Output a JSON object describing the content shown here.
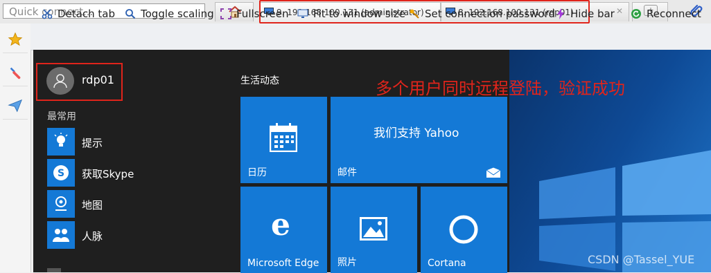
{
  "quick_connect": {
    "placeholder": "Quick connect..."
  },
  "tabs": [
    {
      "label": "9. 192.168.100.131 (administrator)"
    },
    {
      "label": "8. 192.168.100.131 (rdp01)"
    }
  ],
  "toolbar": {
    "detach": "Detach tab",
    "toggle_scaling": "Toggle scaling",
    "fullscreen": "Fullscreen",
    "fit": "Fit to window size",
    "set_password": "Set connection password",
    "hide_bar": "Hide bar",
    "reconnect": "Reconnect"
  },
  "start_menu": {
    "username": "rdp01",
    "most_used_header": "最常用",
    "apps": [
      {
        "label": "提示",
        "icon": "lightbulb-icon"
      },
      {
        "label": "获取Skype",
        "icon": "skype-icon"
      },
      {
        "label": "地图",
        "icon": "maps-icon"
      },
      {
        "label": "人脉",
        "icon": "people-icon"
      }
    ],
    "live_header": "生活动态",
    "tiles": {
      "calendar": "日历",
      "mail_title": "我们支持 Yahoo",
      "mail": "邮件",
      "edge": "Microsoft Edge",
      "photos": "照片",
      "cortana": "Cortana"
    }
  },
  "annotation": "多个用户同时远程登陆，验证成功",
  "watermark": "CSDN @Tassel_YUE",
  "colors": {
    "highlight": "#e0241b",
    "tile": "#1479d6",
    "start_bg": "#1f1f1f"
  }
}
